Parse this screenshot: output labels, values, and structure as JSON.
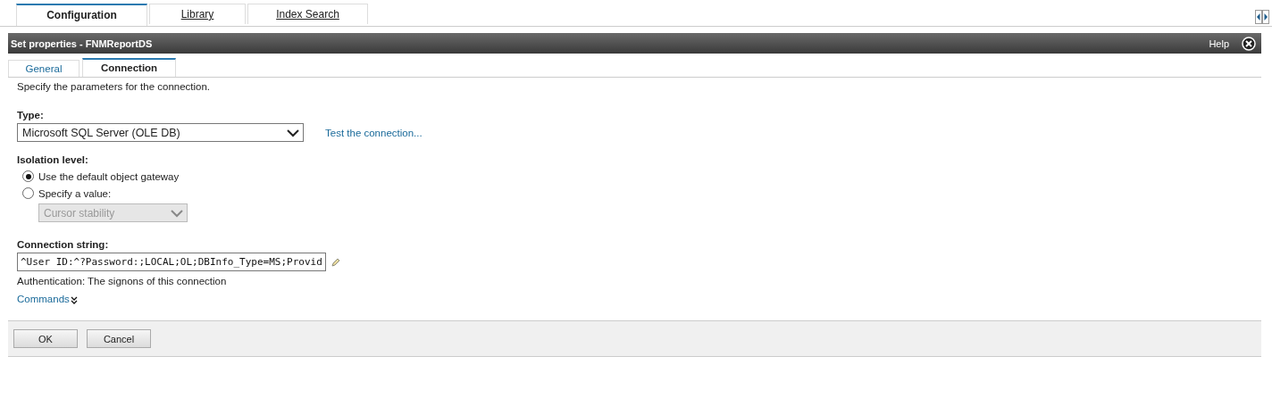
{
  "top_tabs": [
    {
      "label": "Configuration",
      "selected": true
    },
    {
      "label": "Library",
      "selected": false
    },
    {
      "label": "Index Search",
      "selected": false
    }
  ],
  "dialog": {
    "title": "Set properties - FNMReportDS",
    "help": "Help"
  },
  "tabs": [
    {
      "label": "General",
      "selected": false
    },
    {
      "label": "Connection",
      "selected": true
    }
  ],
  "intro": "Specify the parameters for the connection.",
  "type": {
    "label": "Type:",
    "value": "Microsoft SQL Server (OLE DB)",
    "link": "Test the connection..."
  },
  "isolation": {
    "label": "Isolation level:",
    "options": [
      {
        "label": "Use the default object gateway",
        "selected": true
      },
      {
        "label": "Specify a value:",
        "selected": false
      }
    ],
    "value_select": {
      "value": "Cursor stability",
      "disabled": true
    }
  },
  "connection_string": {
    "label": "Connection string:",
    "value": "^User ID:^?Password:;LOCAL;OL;DBInfo_Type=MS;Provid"
  },
  "authentication": "Authentication: The signons of this connection",
  "commands": {
    "label": "Commands",
    "expanded": false
  },
  "buttons": [
    "OK",
    "Cancel"
  ]
}
